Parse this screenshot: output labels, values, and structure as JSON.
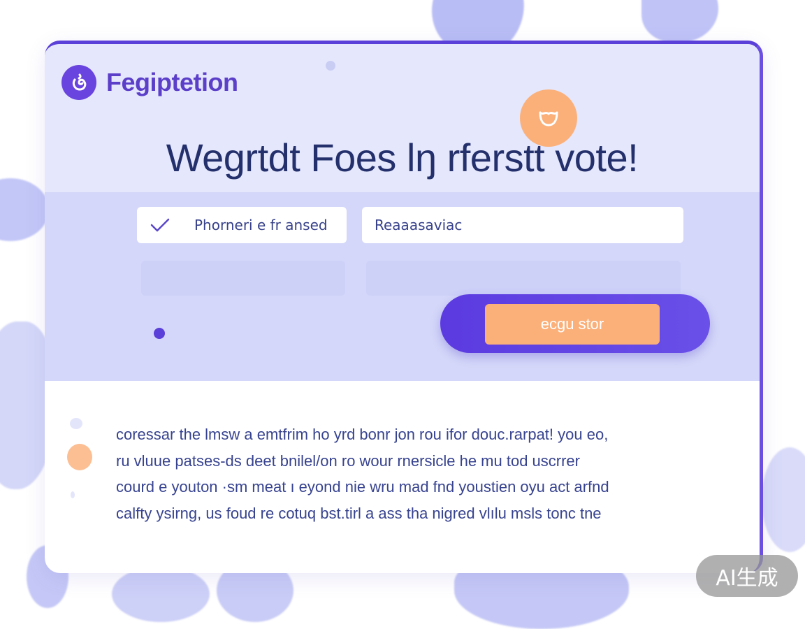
{
  "brand": {
    "name": "Fegiptetion",
    "logo_icon": "swirl-logo-icon",
    "color": "#5b3fc9"
  },
  "hero": {
    "headline": "Wegrtdt Foes lŋ rferstt vote!",
    "badge_icon": "cup-icon"
  },
  "form": {
    "field_1": {
      "value": "Phorneri e fr ansed",
      "icon": "check-icon"
    },
    "field_2": {
      "value": "Reaaasaviac"
    },
    "submit_label": "ecgu stor"
  },
  "body": {
    "lines": [
      "coressar the lmsw  a emtfrim ho yrd bonr jon rou  ifor douc.rarpat!  you eo,",
      "ru vluue patses-ds deet bnilel/on ro wour rnersicle he mu tod uscrrer",
      "courd e youton ·sm meat ı eyond nie wru mad fnd youstien oyu act arfnd",
      "calfty ysirng,  us foud re cotuq bst.tirl a ass tha nigred vlılu msls tonc tne"
    ]
  },
  "watermark": "AI生成",
  "colors": {
    "accent": "#5a3fd8",
    "cta": "#fbb07a",
    "band": "#d4d7f9",
    "hero_bg": "#e5e7fc"
  }
}
